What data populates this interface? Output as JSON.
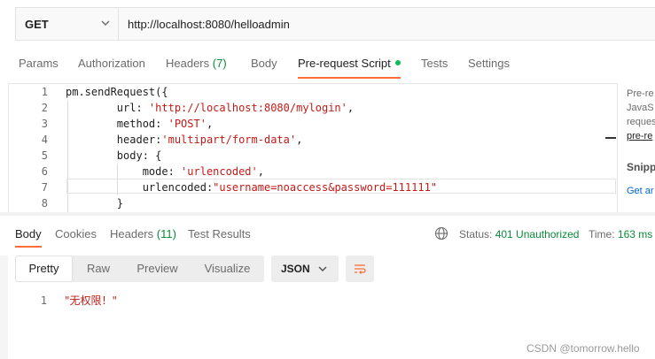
{
  "request": {
    "method": "GET",
    "url": "http://localhost:8080/helloadmin"
  },
  "request_tabs": [
    {
      "label": "Params"
    },
    {
      "label": "Authorization"
    },
    {
      "label": "Headers",
      "count": "(7)"
    },
    {
      "label": "Body"
    },
    {
      "label": "Pre-request Script",
      "active": true
    },
    {
      "label": "Tests"
    },
    {
      "label": "Settings"
    }
  ],
  "editor": {
    "lines": [
      {
        "n": "1",
        "parts": [
          [
            "pm.sendRequest({",
            "plain"
          ]
        ]
      },
      {
        "n": "2",
        "parts": [
          [
            "        url: ",
            "plain"
          ],
          [
            "'http://localhost:8080/mylogin'",
            "str"
          ],
          [
            ",",
            "plain"
          ]
        ]
      },
      {
        "n": "3",
        "parts": [
          [
            "        method: ",
            "plain"
          ],
          [
            "'POST'",
            "str"
          ],
          [
            ",",
            "plain"
          ]
        ]
      },
      {
        "n": "4",
        "parts": [
          [
            "        header:",
            "plain"
          ],
          [
            "'multipart/form-data'",
            "str"
          ],
          [
            ",",
            "plain"
          ]
        ]
      },
      {
        "n": "5",
        "parts": [
          [
            "        body: {",
            "plain"
          ]
        ]
      },
      {
        "n": "6",
        "parts": [
          [
            "            mode: ",
            "plain"
          ],
          [
            "'urlencoded'",
            "str"
          ],
          [
            ",",
            "plain"
          ]
        ]
      },
      {
        "n": "7",
        "parts": [
          [
            "            urlencoded:",
            "plain"
          ],
          [
            "\"username=noaccess&password=111111\"",
            "str"
          ]
        ]
      },
      {
        "n": "8",
        "parts": [
          [
            "        }",
            "plain"
          ]
        ]
      }
    ]
  },
  "side_panel": {
    "lines": [
      "Pre-re",
      "JavaS",
      "reques",
      "pre-re"
    ],
    "heading": "Snipp",
    "link": "Get ar"
  },
  "response_tabs": [
    {
      "label": "Body",
      "active": true
    },
    {
      "label": "Cookies"
    },
    {
      "label": "Headers",
      "count": "(11)"
    },
    {
      "label": "Test Results"
    }
  ],
  "response_meta": {
    "status_label": "Status:",
    "status_value": "401 Unauthorized",
    "time_label": "Time:",
    "time_value": "163 ms"
  },
  "view_modes": [
    "Pretty",
    "Raw",
    "Preview",
    "Visualize"
  ],
  "active_view": "Pretty",
  "format": "JSON",
  "response_body": {
    "lines": [
      {
        "n": "1",
        "text": "\"无权限！\""
      }
    ]
  },
  "watermark": "CSDN @tomorrow.hello",
  "colors": {
    "accent": "#ff6c37",
    "string": "#c41a16",
    "success": "#0b8a3a",
    "dot": "#0cbb52"
  }
}
